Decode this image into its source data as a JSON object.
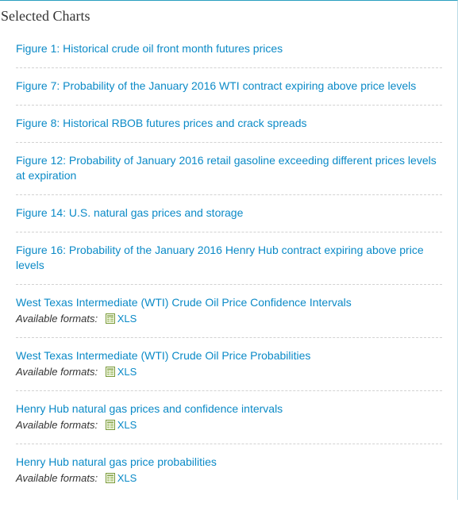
{
  "panel": {
    "title": "Selected Charts"
  },
  "items": [
    {
      "label": "Figure 1: Historical crude oil front month futures prices"
    },
    {
      "label": "Figure 7: Probability of the January 2016 WTI contract expiring above price levels"
    },
    {
      "label": "Figure 8: Historical RBOB futures prices and crack spreads"
    },
    {
      "label": "Figure 12: Probability of January 2016 retail gasoline exceeding different prices levels at expiration"
    },
    {
      "label": "Figure 14: U.S. natural gas prices and storage"
    },
    {
      "label": "Figure 16: Probability of the January 2016 Henry Hub contract expiring above price levels"
    },
    {
      "label": "West Texas Intermediate (WTI) Crude Oil Price Confidence Intervals",
      "formats_label": "Available formats:",
      "format": "XLS"
    },
    {
      "label": "West Texas Intermediate (WTI) Crude Oil Price Probabilities",
      "formats_label": "Available formats:",
      "format": "XLS"
    },
    {
      "label": "Henry Hub natural gas prices and confidence intervals",
      "formats_label": "Available formats:",
      "format": "XLS"
    },
    {
      "label": "Henry Hub natural gas price probabilities",
      "formats_label": "Available formats:",
      "format": "XLS"
    }
  ],
  "colors": {
    "link": "#0b8ac7",
    "text": "#333333",
    "divider": "#d2d2d2",
    "accent": "#2a9fbf"
  },
  "icons": {
    "format_icon": "spreadsheet-file-icon"
  }
}
